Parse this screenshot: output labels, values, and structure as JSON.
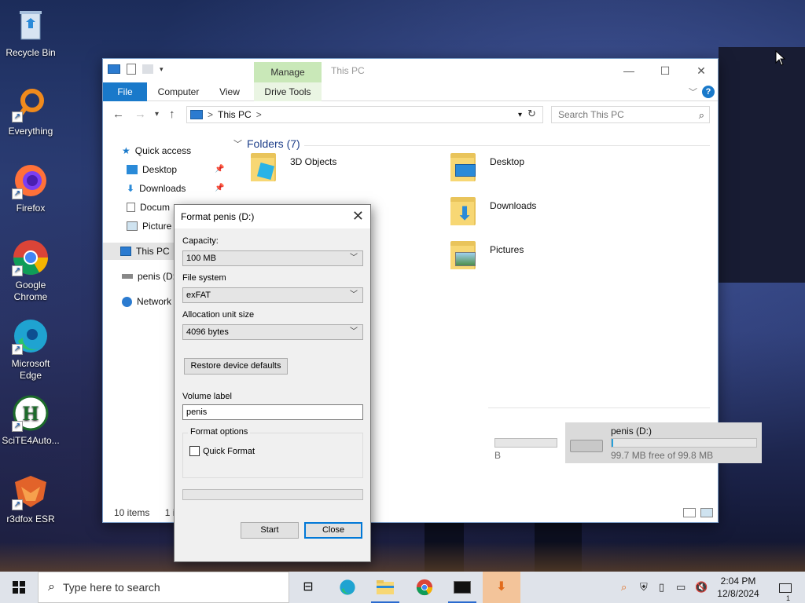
{
  "desktop": {
    "icons": [
      {
        "label": "Recycle Bin",
        "icon": "recycle-bin-icon"
      },
      {
        "label": "Everything",
        "icon": "everything-search-icon"
      },
      {
        "label": "Firefox",
        "icon": "firefox-icon"
      },
      {
        "label": "Google Chrome",
        "icon": "chrome-icon"
      },
      {
        "label": "Microsoft Edge",
        "icon": "edge-icon"
      },
      {
        "label": "SciTE4Auto...",
        "icon": "scite-icon"
      },
      {
        "label": "r3dfox ESR",
        "icon": "r3dfox-icon"
      }
    ]
  },
  "explorer": {
    "title": "This PC",
    "context_tab": "Manage",
    "ribbon_tabs": [
      "File",
      "Computer",
      "View",
      "Drive Tools"
    ],
    "address": {
      "location": "This PC",
      "separator": ">",
      "search_placeholder": "Search This PC"
    },
    "nav": {
      "quick_access": "Quick access",
      "desktop": "Desktop",
      "downloads": "Downloads",
      "documents": "Docum",
      "pictures": "Picture",
      "this_pc": "This PC",
      "drive": "penis (D:",
      "network": "Network"
    },
    "folders_heading": "Folders (7)",
    "folders": [
      "3D Objects",
      "Desktop",
      "Downloads",
      "Pictures"
    ],
    "drives": {
      "c_partial_text": "B",
      "d_name": "penis (D:)",
      "d_free": "99.7 MB free of 99.8 MB",
      "d_used_fraction": 0.01
    },
    "status": {
      "items": "10 items",
      "selected_partial": "1 i"
    }
  },
  "format_dialog": {
    "title": "Format penis (D:)",
    "capacity_label": "Capacity:",
    "capacity_value": "100 MB",
    "filesystem_label": "File system",
    "filesystem_value": "exFAT",
    "allocation_label": "Allocation unit size",
    "allocation_value": "4096 bytes",
    "restore_button": "Restore device defaults",
    "volume_label": "Volume label",
    "volume_value": "penis",
    "options_legend": "Format options",
    "quick_format": "Quick Format",
    "quick_format_checked": false,
    "start_button": "Start",
    "close_button": "Close"
  },
  "taskbar": {
    "search_placeholder": "Type here to search",
    "time": "2:04 PM",
    "date": "12/8/2024",
    "notification_count": "1"
  },
  "colors": {
    "accent": "#1979ca",
    "manage_tab": "#c9e8b8",
    "taskbar": "#dfe3ea"
  }
}
